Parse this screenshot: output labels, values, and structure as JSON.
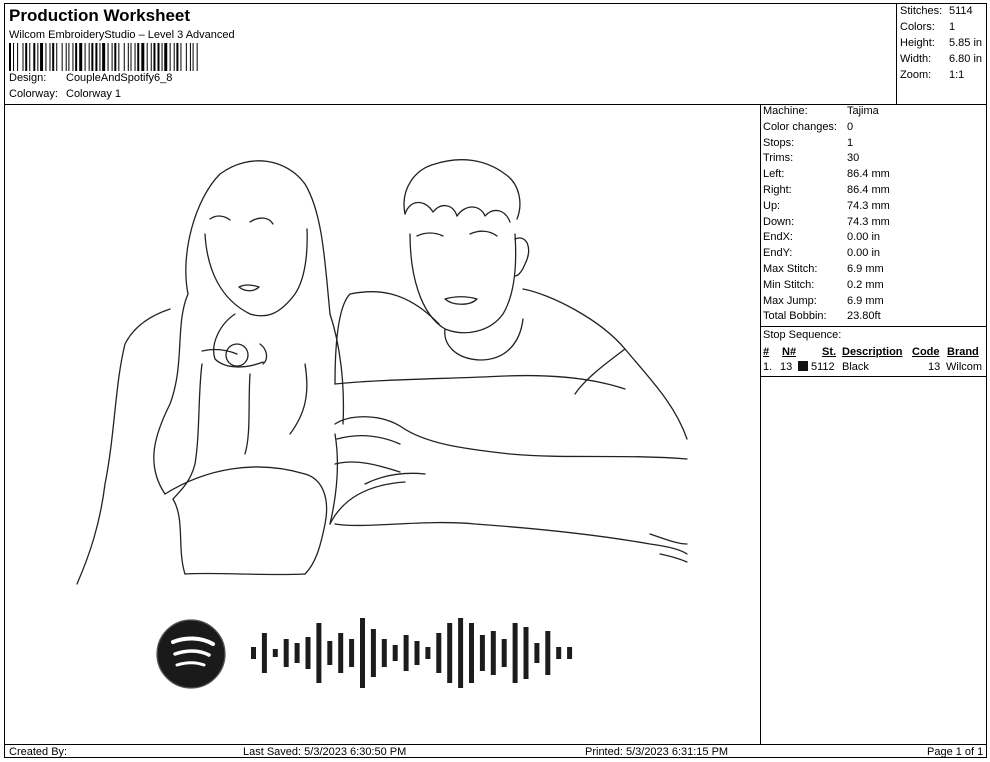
{
  "header": {
    "title": "Production Worksheet",
    "software": "Wilcom EmbroideryStudio – Level 3 Advanced",
    "design_label": "Design:",
    "design_value": "CoupleAndSpotify6_8",
    "colorway_label": "Colorway:",
    "colorway_value": "Colorway 1"
  },
  "stats": [
    {
      "label": "Stitches:",
      "value": "5114"
    },
    {
      "label": "Colors:",
      "value": "1"
    },
    {
      "label": "Height:",
      "value": "5.85 in"
    },
    {
      "label": "Width:",
      "value": "6.80 in"
    },
    {
      "label": "Zoom:",
      "value": "1:1"
    }
  ],
  "machine_info": [
    {
      "label": "Machine:",
      "value": "Tajima"
    },
    {
      "label": "Color changes:",
      "value": "0"
    },
    {
      "label": "Stops:",
      "value": "1"
    },
    {
      "label": "Trims:",
      "value": "30"
    },
    {
      "label": "Left:",
      "value": "86.4 mm"
    },
    {
      "label": "Right:",
      "value": "86.4 mm"
    },
    {
      "label": "Up:",
      "value": "74.3 mm"
    },
    {
      "label": "Down:",
      "value": "74.3 mm"
    },
    {
      "label": "EndX:",
      "value": "0.00 in"
    },
    {
      "label": "EndY:",
      "value": "0.00 in"
    },
    {
      "label": "Max Stitch:",
      "value": "6.9 mm"
    },
    {
      "label": "Min Stitch:",
      "value": "0.2 mm"
    },
    {
      "label": "Max Jump:",
      "value": "6.9 mm"
    },
    {
      "label": "Total Bobbin:",
      "value": "23.80ft"
    }
  ],
  "stop_sequence": {
    "title": "Stop Sequence:",
    "headers": {
      "num": "#",
      "n": "N#",
      "st": "St.",
      "desc": "Description",
      "code": "Code",
      "brand": "Brand"
    },
    "rows": [
      {
        "num": "1.",
        "n": "13",
        "st": "5112",
        "desc": "Black",
        "code": "13",
        "brand": "Wilcom",
        "color": "#111111"
      }
    ]
  },
  "footer": {
    "created": "Created By:",
    "saved": "Last Saved: 5/3/2023 6:30:50 PM",
    "printed": "Printed: 5/3/2023 6:31:15 PM",
    "page": "Page 1 of 1"
  },
  "design_icons": [
    "spotify-logo-icon",
    "sound-wave-code"
  ]
}
